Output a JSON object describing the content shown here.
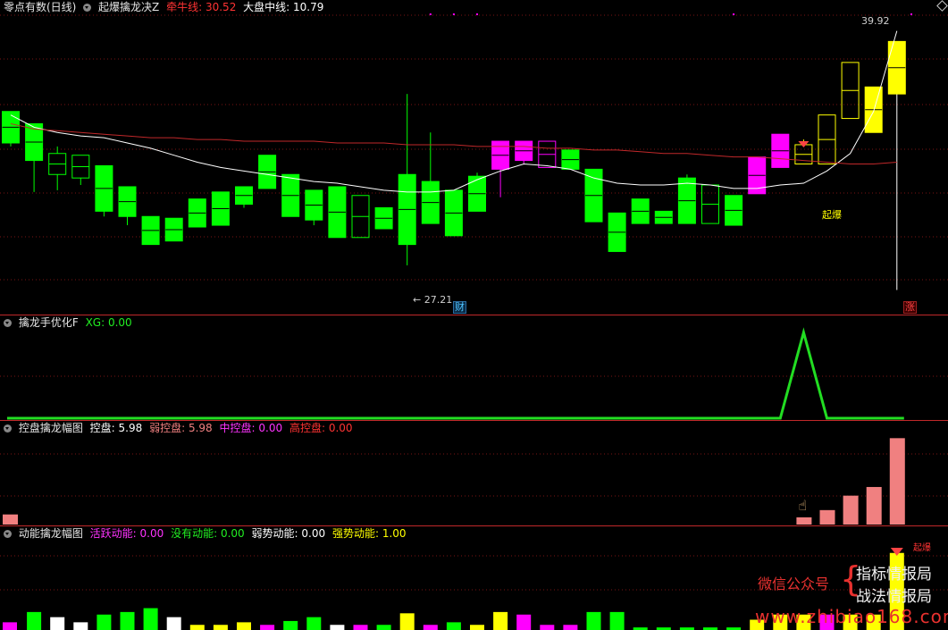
{
  "panels": {
    "main": {
      "title": "零点有数(日线)",
      "indicator": "起爆擒龙决Z",
      "line1_label": "牵牛线:",
      "line1_value": "30.52",
      "line2_label": "大盘中线:",
      "line2_value": "10.79",
      "high_label": "39.92",
      "low_label": "27.21",
      "badge_cai": "财",
      "badge_zhang": "涨",
      "signal_label": "起爆"
    },
    "p2": {
      "title": "擒龙手优化F",
      "xg_label": "XG:",
      "xg_value": "0.00"
    },
    "p3": {
      "title": "控盘擒龙幅图",
      "k1_label": "控盘:",
      "k1_value": "5.98",
      "k2_label": "弱控盘:",
      "k2_value": "5.98",
      "k3_label": "中控盘:",
      "k3_value": "0.00",
      "k4_label": "高控盘:",
      "k4_value": "0.00"
    },
    "p4": {
      "title": "动能擒龙幅图",
      "d1_label": "活跃动能:",
      "d1_value": "0.00",
      "d2_label": "没有动能:",
      "d2_value": "0.00",
      "d3_label": "弱势动能:",
      "d3_value": "0.00",
      "d4_label": "强势动能:",
      "d4_value": "1.00",
      "top_label": "起爆"
    }
  },
  "watermark": {
    "left": "微信公众号",
    "right1": "指标情报局",
    "right2": "战法情报局",
    "site": "www.zhibiao168.com"
  },
  "colors": {
    "up_green": "#00ff00",
    "magenta": "#ff00ff",
    "yellow": "#ffff00",
    "white": "#ffffff",
    "red_line": "#c0282a",
    "salmon": "#f08080"
  },
  "chart_data": [
    {
      "type": "candlestick",
      "name": "main",
      "ylim": [
        24.5,
        41.5
      ],
      "candles": [
        {
          "o": 34.2,
          "c": 36.0,
          "h": 36.0,
          "l": 34.0,
          "color": "green",
          "fill": "solid"
        },
        {
          "o": 33.2,
          "c": 35.3,
          "h": 35.3,
          "l": 31.4,
          "color": "green",
          "fill": "solid"
        },
        {
          "o": 32.4,
          "c": 33.6,
          "h": 34.0,
          "l": 31.5,
          "color": "green",
          "fill": "hollow"
        },
        {
          "o": 32.2,
          "c": 33.5,
          "h": 33.5,
          "l": 31.8,
          "color": "green",
          "fill": "hollow"
        },
        {
          "o": 30.3,
          "c": 32.9,
          "h": 32.9,
          "l": 30.0,
          "color": "green",
          "fill": "solid"
        },
        {
          "o": 30.0,
          "c": 31.7,
          "h": 31.7,
          "l": 29.5,
          "color": "green",
          "fill": "solid"
        },
        {
          "o": 28.4,
          "c": 30.0,
          "h": 30.0,
          "l": 28.4,
          "color": "green",
          "fill": "solid"
        },
        {
          "o": 28.6,
          "c": 29.9,
          "h": 29.9,
          "l": 28.6,
          "color": "green",
          "fill": "solid"
        },
        {
          "o": 29.4,
          "c": 31.0,
          "h": 31.0,
          "l": 29.4,
          "color": "green",
          "fill": "solid"
        },
        {
          "o": 29.5,
          "c": 31.4,
          "h": 31.4,
          "l": 29.5,
          "color": "green",
          "fill": "solid"
        },
        {
          "o": 30.7,
          "c": 31.7,
          "h": 31.7,
          "l": 30.5,
          "color": "green",
          "fill": "solid"
        },
        {
          "o": 31.6,
          "c": 33.5,
          "h": 33.5,
          "l": 31.6,
          "color": "green",
          "fill": "solid"
        },
        {
          "o": 30.0,
          "c": 32.4,
          "h": 32.4,
          "l": 30.0,
          "color": "green",
          "fill": "solid"
        },
        {
          "o": 29.8,
          "c": 31.5,
          "h": 31.5,
          "l": 29.5,
          "color": "green",
          "fill": "solid"
        },
        {
          "o": 28.8,
          "c": 31.7,
          "h": 31.7,
          "l": 28.8,
          "color": "green",
          "fill": "solid"
        },
        {
          "o": 28.8,
          "c": 31.2,
          "h": 31.2,
          "l": 28.8,
          "color": "green",
          "fill": "hollow"
        },
        {
          "o": 29.3,
          "c": 30.5,
          "h": 30.5,
          "l": 29.3,
          "color": "green",
          "fill": "solid"
        },
        {
          "o": 28.4,
          "c": 32.4,
          "h": 37.0,
          "l": 27.21,
          "color": "green",
          "fill": "solid"
        },
        {
          "o": 29.6,
          "c": 32.0,
          "h": 34.8,
          "l": 29.6,
          "color": "green",
          "fill": "solid"
        },
        {
          "o": 28.9,
          "c": 31.5,
          "h": 31.5,
          "l": 28.9,
          "color": "green",
          "fill": "solid"
        },
        {
          "o": 30.3,
          "c": 32.3,
          "h": 32.5,
          "l": 30.3,
          "color": "green",
          "fill": "solid"
        },
        {
          "o": 34.3,
          "c": 32.7,
          "h": 34.3,
          "l": 31.1,
          "color": "magenta",
          "fill": "solid"
        },
        {
          "o": 34.3,
          "c": 33.2,
          "h": 34.3,
          "l": 33.0,
          "color": "magenta",
          "fill": "solid"
        },
        {
          "o": 34.3,
          "c": 32.8,
          "h": 34.3,
          "l": 32.8,
          "color": "magenta",
          "fill": "hollow"
        },
        {
          "o": 32.7,
          "c": 33.8,
          "h": 33.8,
          "l": 32.7,
          "color": "green",
          "fill": "solid"
        },
        {
          "o": 29.7,
          "c": 32.7,
          "h": 32.7,
          "l": 29.7,
          "color": "green",
          "fill": "solid"
        },
        {
          "o": 28.0,
          "c": 30.2,
          "h": 30.2,
          "l": 28.0,
          "color": "green",
          "fill": "solid"
        },
        {
          "o": 29.6,
          "c": 31.0,
          "h": 31.0,
          "l": 29.6,
          "color": "green",
          "fill": "solid"
        },
        {
          "o": 29.6,
          "c": 30.3,
          "h": 30.3,
          "l": 29.6,
          "color": "green",
          "fill": "solid"
        },
        {
          "o": 29.6,
          "c": 32.2,
          "h": 32.4,
          "l": 29.6,
          "color": "green",
          "fill": "solid"
        },
        {
          "o": 29.6,
          "c": 31.8,
          "h": 31.8,
          "l": 29.6,
          "color": "green",
          "fill": "hollow"
        },
        {
          "o": 29.5,
          "c": 31.2,
          "h": 31.2,
          "l": 29.5,
          "color": "green",
          "fill": "solid"
        },
        {
          "o": 33.4,
          "c": 31.3,
          "h": 33.4,
          "l": 31.3,
          "color": "magenta",
          "fill": "solid"
        },
        {
          "o": 34.7,
          "c": 32.8,
          "h": 34.7,
          "l": 32.8,
          "color": "magenta",
          "fill": "solid"
        },
        {
          "o": 33.0,
          "c": 34.1,
          "h": 34.4,
          "l": 33.0,
          "color": "yellow",
          "fill": "hollow"
        },
        {
          "o": 33.0,
          "c": 35.8,
          "h": 35.8,
          "l": 33.0,
          "color": "yellow",
          "fill": "hollow"
        },
        {
          "o": 35.6,
          "c": 38.8,
          "h": 38.8,
          "l": 35.6,
          "color": "yellow",
          "fill": "hollow"
        },
        {
          "o": 34.8,
          "c": 37.4,
          "h": 37.4,
          "l": 34.8,
          "color": "yellow",
          "fill": "solid"
        },
        {
          "o": 37.0,
          "c": 40.0,
          "h": 40.0,
          "l": 25.8,
          "color": "yellow",
          "fill": "solid"
        }
      ],
      "series": [
        {
          "name": "牵牛线",
          "color": "white",
          "values": [
            35.8,
            35.1,
            34.8,
            34.6,
            34.5,
            34.2,
            33.9,
            33.5,
            33.1,
            32.8,
            32.6,
            32.4,
            32.2,
            32.0,
            31.9,
            31.7,
            31.5,
            31.4,
            31.4,
            31.5,
            32.1,
            32.6,
            33.0,
            32.9,
            32.7,
            32.2,
            31.9,
            31.8,
            31.8,
            31.9,
            31.8,
            31.6,
            31.6,
            31.8,
            31.9,
            32.6,
            33.6,
            36.0,
            40.6
          ]
        },
        {
          "name": "大盘中线",
          "color": "red",
          "values": [
            35.3,
            35.0,
            34.9,
            34.8,
            34.7,
            34.6,
            34.5,
            34.5,
            34.4,
            34.4,
            34.3,
            34.3,
            34.3,
            34.3,
            34.2,
            34.2,
            34.2,
            34.1,
            34.1,
            34.1,
            34.0,
            34.0,
            34.0,
            33.9,
            33.9,
            33.8,
            33.8,
            33.7,
            33.6,
            33.6,
            33.5,
            33.4,
            33.4,
            33.3,
            33.2,
            33.1,
            33.0,
            33.0,
            33.1
          ]
        }
      ],
      "top_markers": [
        18,
        19,
        20,
        31
      ]
    },
    {
      "type": "line",
      "name": "擒龙手优化F",
      "series": [
        {
          "name": "XG",
          "values": [
            0,
            0,
            0,
            0,
            0,
            0,
            0,
            0,
            0,
            0,
            0,
            0,
            0,
            0,
            0,
            0,
            0,
            0,
            0,
            0,
            0,
            0,
            0,
            0,
            0,
            0,
            0,
            0,
            0,
            0,
            0,
            0,
            0,
            0,
            1,
            0,
            0,
            0,
            0
          ]
        }
      ],
      "ylim": [
        0,
        1
      ]
    },
    {
      "type": "bar",
      "name": "控盘擒龙幅图",
      "series": [
        {
          "name": "弱控盘",
          "values": [
            0.7,
            0,
            0,
            0,
            0,
            0,
            0,
            0,
            0,
            0,
            0,
            0,
            0,
            0,
            0,
            0,
            0,
            0,
            0,
            0,
            0,
            0,
            0,
            0,
            0,
            0,
            0,
            0,
            0,
            0,
            0,
            0,
            0,
            0,
            0.5,
            1.0,
            2.0,
            2.6,
            5.98
          ]
        }
      ],
      "ylim": [
        0,
        12
      ]
    },
    {
      "type": "bar",
      "name": "动能擒龙幅图",
      "values": [
        0.3,
        0.7,
        0.5,
        0.3,
        0.6,
        0.7,
        0.85,
        0.5,
        0.2,
        0.2,
        0.3,
        0.2,
        0.35,
        0.5,
        0.2,
        0.2,
        0.2,
        0.65,
        0.2,
        0.3,
        0.2,
        0.7,
        0.6,
        0.2,
        0.2,
        0.7,
        0.7,
        0.1,
        0.1,
        0.1,
        0.1,
        0.1,
        0.4,
        0.6,
        0.6,
        0.6,
        0.6,
        0.6,
        3.0
      ],
      "colors": [
        "magenta",
        "green",
        "white",
        "white",
        "green",
        "green",
        "green",
        "white",
        "yellow",
        "yellow",
        "yellow",
        "magenta",
        "green",
        "green",
        "white",
        "magenta",
        "green",
        "yellow",
        "magenta",
        "green",
        "yellow",
        "yellow",
        "magenta",
        "magenta",
        "magenta",
        "green",
        "green",
        "green",
        "green",
        "green",
        "green",
        "green",
        "yellow",
        "yellow",
        "yellow",
        "magenta",
        "yellow",
        "yellow",
        "yellow"
      ],
      "ylim": [
        0,
        4
      ]
    }
  ]
}
